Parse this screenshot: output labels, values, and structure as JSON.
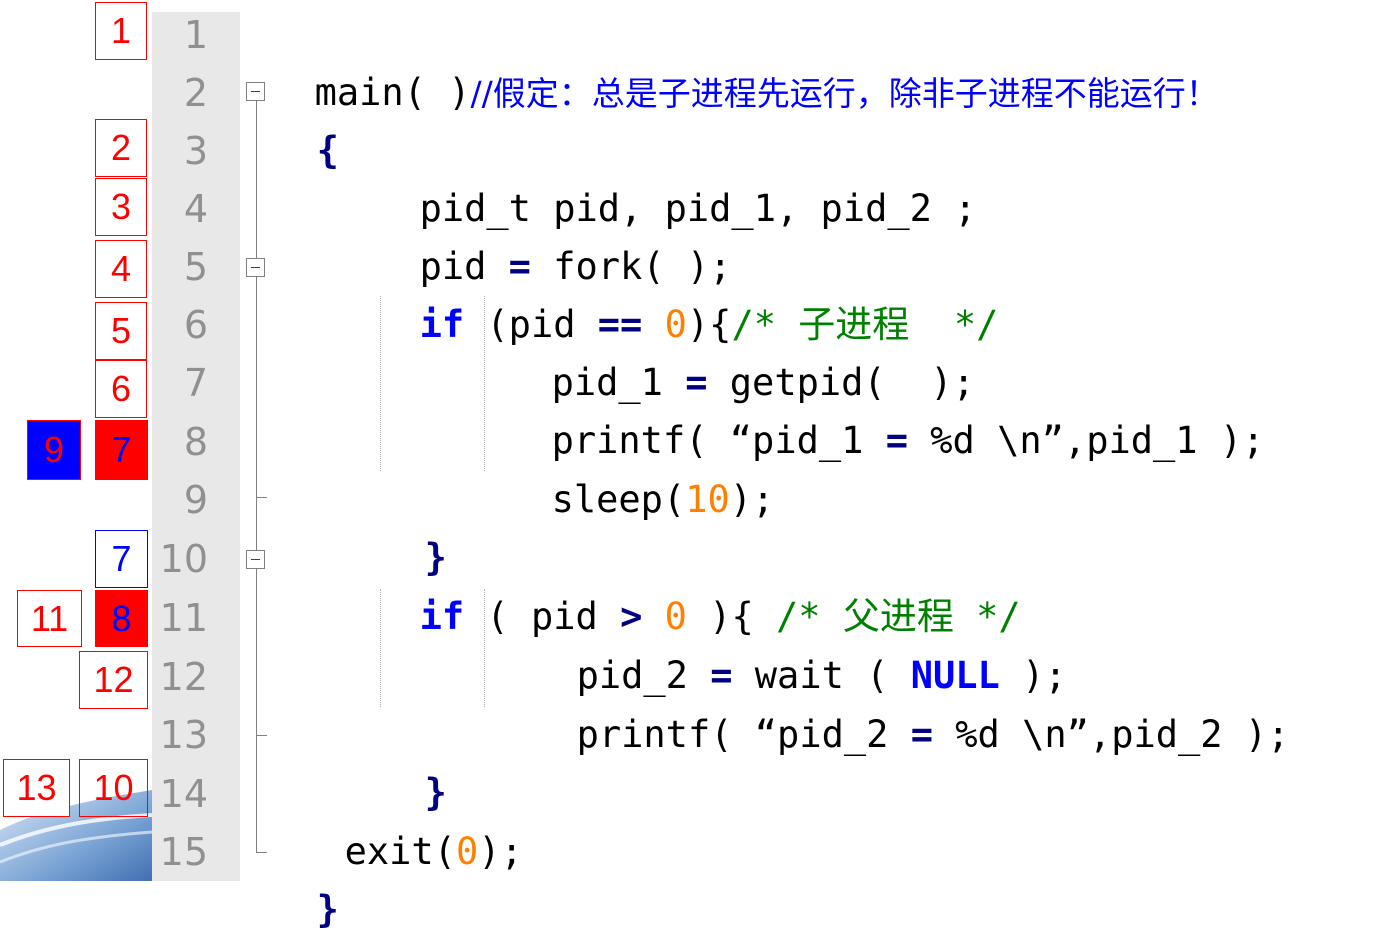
{
  "line_numbers": [
    "1",
    "2",
    "3",
    "4",
    "5",
    "6",
    "7",
    "8",
    "9",
    "10",
    "11",
    "12",
    "13",
    "14",
    "15"
  ],
  "code": {
    "l1_main": "main( )",
    "l1_comment": "//假定：总是子进程先运行，除非子进程不能运行！",
    "l2": "{",
    "l3": "pid_t pid, pid_1, pid_2 ;",
    "l4_a": "pid ",
    "l4_eq": "=",
    "l4_b": " fork( );",
    "l5_if": "if",
    "l5_a": " (pid ",
    "l5_op": "==",
    "l5_sp": " ",
    "l5_num": "0",
    "l5_b": "){",
    "l5_com_a": "/* ",
    "l5_com_zh": "子进程",
    "l5_com_b": "  */",
    "l6_a": "pid_1 ",
    "l6_eq": "=",
    "l6_b": " getpid(  );",
    "l7_a": "printf( “pid_1 ",
    "l7_eq": "=",
    "l7_b": " %d \\n”,pid_1 );",
    "l8_a": "sleep(",
    "l8_num": "10",
    "l8_b": ");",
    "l9": "}",
    "l10_if": "if",
    "l10_a": " ( pid ",
    "l10_op": ">",
    "l10_sp": " ",
    "l10_num": "0",
    "l10_b": " ){ ",
    "l10_com_a": "/* ",
    "l10_com_zh": "父进程",
    "l10_com_b": " */",
    "l11_a": "pid_2 ",
    "l11_eq": "=",
    "l11_b": " wait ( ",
    "l11_null": "NULL",
    "l11_c": " );",
    "l12_a": "printf( “pid_2 ",
    "l12_eq": "=",
    "l12_b": " %d \\n”,pid_2 );",
    "l13": "}",
    "l14_a": "exit(",
    "l14_num": "0",
    "l14_b": ");",
    "l15": "}"
  },
  "step_markers": {
    "m1": "1",
    "m2": "2",
    "m3": "3",
    "m4": "4",
    "m5": "5",
    "m6": "6",
    "m7_line8": "7",
    "m9": "9",
    "m7_line10": "7",
    "m8": "8",
    "m11": "11",
    "m12": "12",
    "m13": "13",
    "m10": "10"
  },
  "colors": {
    "keyword": "#0000ff",
    "number": "#ff8000",
    "comment": "#008000",
    "marker_red": "#ff0000",
    "marker_blue": "#0000ff",
    "gutter": "#e8e8e8"
  }
}
